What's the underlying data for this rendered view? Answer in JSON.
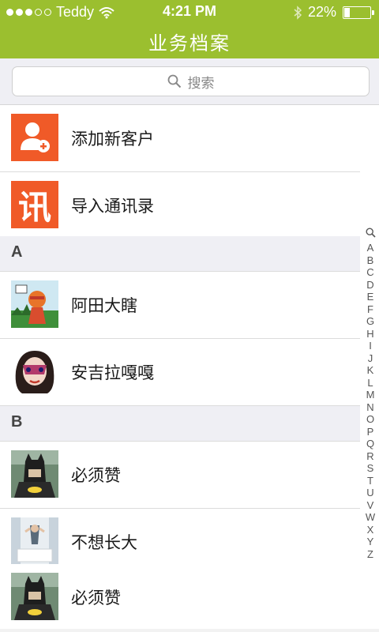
{
  "status_bar": {
    "carrier": "Teddy",
    "time": "4:21 PM",
    "battery": "22%",
    "battery_level": 0.22,
    "signal_dots": [
      true,
      true,
      true,
      false,
      false
    ]
  },
  "nav": {
    "title": "业务档案"
  },
  "search": {
    "placeholder": "搜索"
  },
  "actions": [
    {
      "label": "添加新客户",
      "icon": "add-user-icon",
      "color": "#f05a28"
    },
    {
      "label": "导入通讯录",
      "icon": "xun-icon",
      "color": "#f05a28",
      "icon_text": "讯"
    }
  ],
  "sections": [
    {
      "letter": "A",
      "contacts": [
        "阿田大瞎",
        "安吉拉嘎嘎"
      ]
    },
    {
      "letter": "B",
      "contacts": [
        "必须赞",
        "不想长大",
        "必须赞"
      ]
    }
  ],
  "index_letters": [
    "A",
    "B",
    "C",
    "D",
    "E",
    "F",
    "G",
    "H",
    "I",
    "J",
    "K",
    "L",
    "M",
    "N",
    "O",
    "P",
    "Q",
    "R",
    "S",
    "T",
    "U",
    "V",
    "W",
    "X",
    "Y",
    "Z"
  ],
  "colors": {
    "accent": "#9bbf2f",
    "action_icon_bg": "#f05a28",
    "section_bg": "#efeff4"
  }
}
